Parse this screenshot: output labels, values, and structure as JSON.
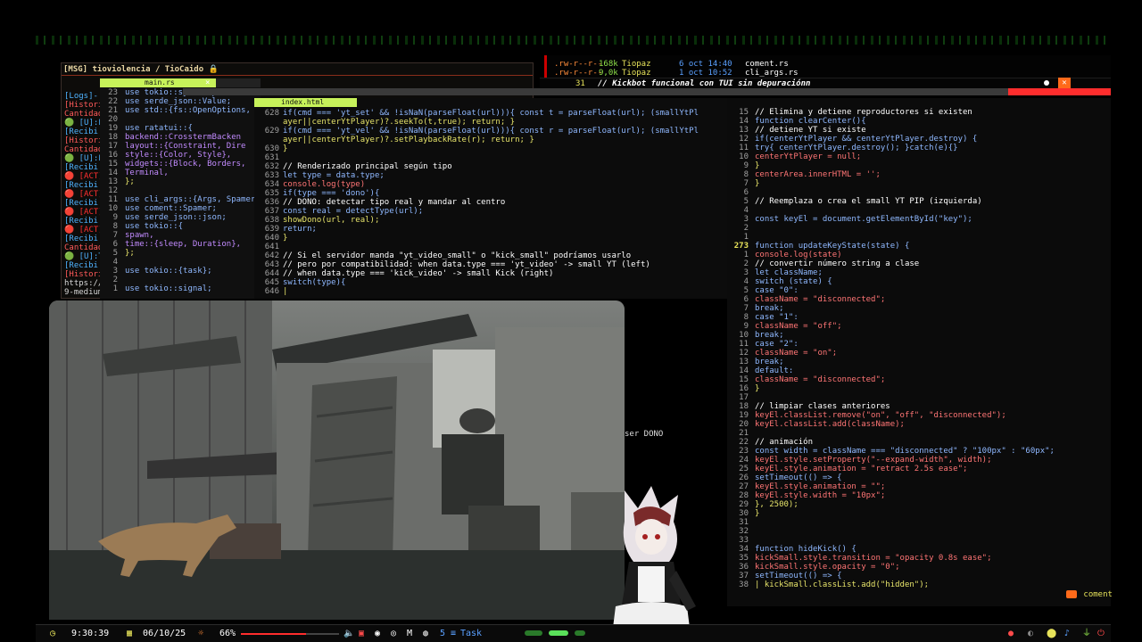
{
  "chat": {
    "header": "[MSG] tioviolencia / TioCaido 🔒",
    "lines": [
      {
        "text": "[Logs]-",
        "kind": "log"
      },
      {
        "text": "[Histori",
        "kind": "hist"
      },
      {
        "text": "Cantidad",
        "kind": "hist"
      },
      {
        "text": "🟢 [U]:F",
        "kind": "log"
      },
      {
        "text": "[Recibi",
        "kind": "log"
      },
      {
        "text": "[Histori",
        "kind": "hist"
      },
      {
        "text": "Cantidad",
        "kind": "hist"
      },
      {
        "text": "🟢 [U]:F",
        "kind": "log"
      },
      {
        "text": "[Recibi",
        "kind": "log"
      },
      {
        "text": "🔴 [ACT]",
        "kind": "act"
      },
      {
        "text": "[Recibi",
        "kind": "log"
      },
      {
        "text": "🔴 [ACT]",
        "kind": "act"
      },
      {
        "text": "[Recibi",
        "kind": "log"
      },
      {
        "text": "🔴 [ACT]",
        "kind": "act"
      },
      {
        "text": "[Recibi",
        "kind": "log"
      },
      {
        "text": "🔴 [ACT]",
        "kind": "act"
      },
      {
        "text": "[Recibi",
        "kind": "log"
      },
      {
        "text": "Cantidad",
        "kind": "hist"
      },
      {
        "text": "🟢 [U]:T",
        "kind": "log"
      },
      {
        "text": "[Recibi",
        "kind": "log"
      },
      {
        "text": "[Histori",
        "kind": "hist"
      },
      {
        "text": "https://",
        "kind": "plain"
      },
      {
        "text": "9-medium",
        "kind": "plain"
      }
    ]
  },
  "rust_editor": {
    "tab": "main.rs",
    "lines": [
      {
        "n": "23",
        "t": "use tokio::sync::mpsc;"
      },
      {
        "n": "22",
        "t": "use serde_json::Value;"
      },
      {
        "n": "21",
        "t": "use std::{fs::OpenOptions,"
      },
      {
        "n": "20",
        "t": ""
      },
      {
        "n": "19",
        "t": "use ratatui::{"
      },
      {
        "n": "18",
        "t": "    backend::CrosstermBacken"
      },
      {
        "n": "17",
        "t": "    layout::{Constraint, Dire"
      },
      {
        "n": "16",
        "t": "    style::{Color, Style},"
      },
      {
        "n": "15",
        "t": "    widgets::{Block, Borders,"
      },
      {
        "n": "14",
        "t": "    Terminal,"
      },
      {
        "n": "13",
        "t": "};"
      },
      {
        "n": "12",
        "t": ""
      },
      {
        "n": "11",
        "t": "use cli_args::{Args, SpamerAr"
      },
      {
        "n": "10",
        "t": "use coment::Spamer;"
      },
      {
        "n": "9",
        "t": "use serde_json::json;"
      },
      {
        "n": "8",
        "t": "use tokio::{"
      },
      {
        "n": "7",
        "t": "    spawn,"
      },
      {
        "n": "6",
        "t": "    time::{sleep, Duration},"
      },
      {
        "n": "5",
        "t": "};"
      },
      {
        "n": "4",
        "t": ""
      },
      {
        "n": "3",
        "t": "use tokio::{task};"
      },
      {
        "n": "2",
        "t": ""
      },
      {
        "n": "1",
        "t": "use tokio::signal;"
      }
    ]
  },
  "js_editor": {
    "tab": "index.html",
    "lines": [
      {
        "n": "628",
        "t": "  if(cmd === 'yt_set' && !isNaN(parseFloat(url))){ const t = parseFloat(url); (smallYtPl"
      },
      {
        "n": "",
        "t": "ayer||centerYtPlayer)?.seekTo(t,true); return; }"
      },
      {
        "n": "629",
        "t": "  if(cmd === 'yt_vel' && !isNaN(parseFloat(url))){ const r = parseFloat(url); (smallYtPl"
      },
      {
        "n": "",
        "t": "ayer||centerYtPlayer)?.setPlaybackRate(r); return; }"
      },
      {
        "n": "630",
        "t": "}"
      },
      {
        "n": "631",
        "t": ""
      },
      {
        "n": "632",
        "t": "// Renderizado principal según tipo"
      },
      {
        "n": "633",
        "t": "let type = data.type;"
      },
      {
        "n": "634",
        "t": "console.log(type)"
      },
      {
        "n": "635",
        "t": "if(type === 'dono'){"
      },
      {
        "n": "636",
        "t": "  // DONO: detectar tipo real y mandar al centro"
      },
      {
        "n": "637",
        "t": "  const real = detectType(url);"
      },
      {
        "n": "638",
        "t": "  showDono(url, real);"
      },
      {
        "n": "639",
        "t": "  return;"
      },
      {
        "n": "640",
        "t": "}"
      },
      {
        "n": "641",
        "t": ""
      },
      {
        "n": "642",
        "t": "// Si el servidor manda \"yt_video_small\" o \"kick_small\" podríamos usarlo"
      },
      {
        "n": "643",
        "t": "// pero por compatibilidad: when data.type === 'yt_video' -> small YT (left)"
      },
      {
        "n": "644",
        "t": "// when data.type === 'kick_video' -> small Kick (right)"
      },
      {
        "n": "645",
        "t": "switch(type){"
      },
      {
        "n": "646",
        "t": "  |"
      }
    ]
  },
  "ls": {
    "rows": [
      {
        "perm": ".rw-r--r--",
        "size": "168k",
        "user": "Tiopaz",
        "date": "6 oct 14:40",
        "file": "coment.rs"
      },
      {
        "perm": ".rw-r--r--",
        "size": "9,0k",
        "user": "Tiopaz",
        "date": "1 oct 10:52",
        "file": "cli_args.rs"
      }
    ]
  },
  "git": {
    "num": "31",
    "msg": "// Kickbot funcional con TUI sin depuraciónn"
  },
  "right_editor": {
    "lines": [
      {
        "n": "15",
        "t": "    // Elimina y detiene reproductores si existen"
      },
      {
        "n": "14",
        "t": "    function clearCenter(){"
      },
      {
        "n": "13",
        "t": "      // detiene YT si existe"
      },
      {
        "n": "12",
        "t": "      if(centerYtPlayer && centerYtPlayer.destroy) {"
      },
      {
        "n": "11",
        "t": "        try{ centerYtPlayer.destroy(); }catch(e){}"
      },
      {
        "n": "10",
        "t": "        centerYtPlayer = null;"
      },
      {
        "n": "9",
        "t": "      }"
      },
      {
        "n": "8",
        "t": "      centerArea.innerHTML = '';"
      },
      {
        "n": "7",
        "t": "    }"
      },
      {
        "n": "6",
        "t": ""
      },
      {
        "n": "5",
        "t": "    // Reemplaza o crea el small YT PIP (izquierda)"
      },
      {
        "n": "4",
        "t": ""
      },
      {
        "n": "3",
        "t": "  const keyEl = document.getElementById(\"key\");"
      },
      {
        "n": "2",
        "t": ""
      },
      {
        "n": "1",
        "t": ""
      },
      {
        "n": "273",
        "t": "function updateKeyState(state) {"
      },
      {
        "n": "1",
        "t": "      console.log(state)"
      },
      {
        "n": "2",
        "t": "  // convertir número string a clase"
      },
      {
        "n": "3",
        "t": "  let className;"
      },
      {
        "n": "4",
        "t": "  switch (state) {"
      },
      {
        "n": "5",
        "t": "    case \"0\":"
      },
      {
        "n": "6",
        "t": "      className = \"disconnected\";"
      },
      {
        "n": "7",
        "t": "      break;"
      },
      {
        "n": "8",
        "t": "    case \"1\":"
      },
      {
        "n": "9",
        "t": "      className = \"off\";"
      },
      {
        "n": "10",
        "t": "      break;"
      },
      {
        "n": "11",
        "t": "    case \"2\":"
      },
      {
        "n": "12",
        "t": "      className = \"on\";"
      },
      {
        "n": "13",
        "t": "      break;"
      },
      {
        "n": "14",
        "t": "    default:"
      },
      {
        "n": "15",
        "t": "      className = \"disconnected\";"
      },
      {
        "n": "16",
        "t": "  }"
      },
      {
        "n": "17",
        "t": ""
      },
      {
        "n": "18",
        "t": "  // limpiar clases anteriores"
      },
      {
        "n": "19",
        "t": "  keyEl.classList.remove(\"on\", \"off\", \"disconnected\");"
      },
      {
        "n": "20",
        "t": "  keyEl.classList.add(className);"
      },
      {
        "n": "21",
        "t": ""
      },
      {
        "n": "22",
        "t": "  // animación"
      },
      {
        "n": "23",
        "t": "  const width = className === \"disconnected\" ? \"100px\" : \"60px\";"
      },
      {
        "n": "24",
        "t": "  keyEl.style.setProperty(\"--expand-width\", width);"
      },
      {
        "n": "25",
        "t": "  keyEl.style.animation = \"retract 2.5s ease\";"
      },
      {
        "n": "26",
        "t": "  setTimeout(() => {"
      },
      {
        "n": "27",
        "t": "    keyEl.style.animation = \"\";"
      },
      {
        "n": "28",
        "t": "    keyEl.style.width = \"10px\";"
      },
      {
        "n": "29",
        "t": "  }, 2500);"
      },
      {
        "n": "30",
        "t": "}"
      },
      {
        "n": "31",
        "t": ""
      },
      {
        "n": "32",
        "t": ""
      },
      {
        "n": "33",
        "t": ""
      },
      {
        "n": "34",
        "t": "function hideKick() {"
      },
      {
        "n": "35",
        "t": "  kickSmall.style.transition = \"opacity 0.8s ease\";"
      },
      {
        "n": "36",
        "t": "  kickSmall.style.opacity = \"0\";"
      },
      {
        "n": "37",
        "t": "  setTimeout(() => {"
      },
      {
        "n": "38",
        "t": "  | kickSmall.classList.add(\"hidden\");"
      }
    ]
  },
  "overlay": {
    "dono_fragment": "ser DONO",
    "comment_tag": "coment"
  },
  "taskbar": {
    "time": "9:30:39",
    "date": "06/10/25",
    "volume": "66%",
    "volume_level": 0.66,
    "workspace": "5",
    "task_label": "Task"
  },
  "colors": {
    "accent_green": "#c7f25a",
    "accent_red": "#ff2d2d",
    "accent_orange": "#ff6a1a"
  },
  "icons": [
    "clock-icon",
    "calendar-icon",
    "sun-icon",
    "volume-icon",
    "pdf-icon",
    "discord-icon",
    "steam-icon",
    "mail-icon",
    "obs-icon",
    "terminal-icon"
  ]
}
